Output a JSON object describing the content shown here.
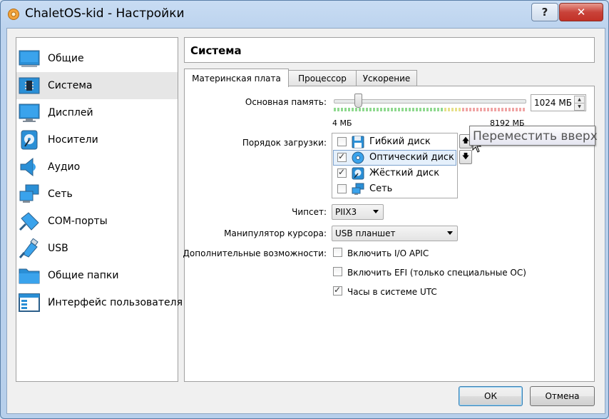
{
  "window": {
    "title": "ChaletOS-kid - Настройки",
    "help_glyph": "?",
    "close_glyph": "✕"
  },
  "sidebar": {
    "items": [
      {
        "label": "Общие",
        "icon": "general-icon"
      },
      {
        "label": "Система",
        "icon": "system-icon",
        "selected": true
      },
      {
        "label": "Дисплей",
        "icon": "display-icon"
      },
      {
        "label": "Носители",
        "icon": "storage-icon"
      },
      {
        "label": "Аудио",
        "icon": "audio-icon"
      },
      {
        "label": "Сеть",
        "icon": "network-icon"
      },
      {
        "label": "COM-порты",
        "icon": "serial-ports-icon"
      },
      {
        "label": "USB",
        "icon": "usb-icon"
      },
      {
        "label": "Общие папки",
        "icon": "shared-folders-icon"
      },
      {
        "label": "Интерфейс пользователя",
        "icon": "user-interface-icon"
      }
    ]
  },
  "header": {
    "title": "Система"
  },
  "tabs": [
    {
      "label": "Материнская плата",
      "active": true
    },
    {
      "label": "Процессор"
    },
    {
      "label": "Ускорение"
    }
  ],
  "motherboard": {
    "memory_label": "Основная память:",
    "memory_min": "4 МБ",
    "memory_max": "8192 МБ",
    "memory_value": "1024 МБ",
    "memory_fraction": 0.125,
    "boot_order_label": "Порядок загрузки:",
    "boot_items": [
      {
        "label": "Гибкий диск",
        "checked": false,
        "icon": "floppy-icon"
      },
      {
        "label": "Оптический диск",
        "checked": true,
        "selected": true,
        "icon": "optical-disc-icon"
      },
      {
        "label": "Жёсткий диск",
        "checked": true,
        "icon": "hard-disk-icon"
      },
      {
        "label": "Сеть",
        "checked": false,
        "icon": "network-icon"
      }
    ],
    "move_up_glyph": "🡅",
    "move_down_glyph": "🡇",
    "tooltip": "Переместить вверх",
    "chipset_label": "Чипсет:",
    "chipset_value": "PIIX3",
    "pointer_label": "Манипулятор курсора:",
    "pointer_value": "USB планшет",
    "extended_label": "Дополнительные возможности:",
    "options": [
      {
        "label": "Включить I/O APIC",
        "checked": false
      },
      {
        "label": "Включить EFI (только специальные ОС)",
        "checked": false
      },
      {
        "label": "Часы в системе UTC",
        "checked": true
      }
    ]
  },
  "buttons": {
    "ok": "ОК",
    "cancel": "Отмена"
  },
  "colors": {
    "accent": "#3c7fb1",
    "close": "#c9433a"
  }
}
